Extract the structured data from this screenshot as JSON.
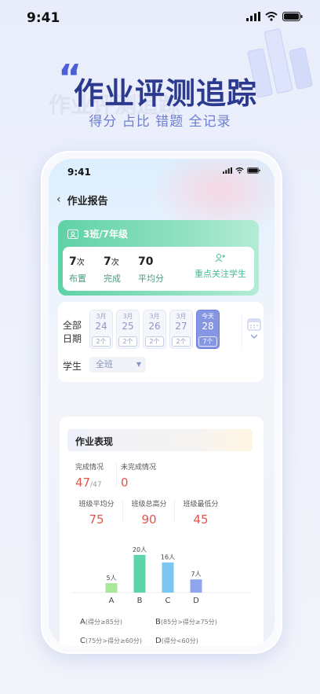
{
  "status_bar": {
    "time": "9:41"
  },
  "hero": {
    "title": "作业评测追踪",
    "subtitle": "得分 占比 错题 全记录",
    "quote_mark": "“",
    "shadow_text": "作业评测追踪"
  },
  "device": {
    "status_time": "9:41",
    "nav": {
      "back_icon": "chevron-left-icon",
      "title": "作业报告"
    },
    "class_card": {
      "name": "3班/7年级",
      "stats": [
        {
          "value": "7",
          "unit": "次",
          "label": "布置"
        },
        {
          "value": "7",
          "unit": "次",
          "label": "完成"
        },
        {
          "value": "70",
          "unit": "",
          "label": "平均分"
        }
      ],
      "focus_label": "重点关注学生",
      "accent": "#5fd2a6"
    },
    "date_filter": {
      "label": "全部日期",
      "dates": [
        {
          "month": "3月",
          "day": "24",
          "count": "2个",
          "active": false
        },
        {
          "month": "3月",
          "day": "25",
          "count": "2个",
          "active": false
        },
        {
          "month": "3月",
          "day": "26",
          "count": "2个",
          "active": false
        },
        {
          "month": "3月",
          "day": "27",
          "count": "2个",
          "active": false
        },
        {
          "month": "今天",
          "day": "28",
          "count": "7个",
          "active": true
        }
      ],
      "student_label": "学生",
      "student_value": "全班"
    },
    "performance": {
      "title": "作业表现",
      "completed_label": "完成情况",
      "completed_value": "47",
      "completed_total": "/47",
      "incomplete_label": "未完成情况",
      "incomplete_value": "0",
      "avg_label": "班级平均分",
      "avg_value": "75",
      "max_label": "班级总高分",
      "max_value": "90",
      "min_label": "班级最低分",
      "min_value": "45",
      "legend": [
        {
          "grade": "A",
          "range": "(得分≥85分)"
        },
        {
          "grade": "B",
          "range": "(85分>得分≥75分)"
        },
        {
          "grade": "C",
          "range": "(75分>得分≥60分)"
        },
        {
          "grade": "D",
          "range": "(得分<60分)"
        }
      ]
    }
  },
  "chart_data": {
    "type": "bar",
    "categories": [
      "A",
      "B",
      "C",
      "D"
    ],
    "values": [
      5,
      20,
      16,
      7
    ],
    "labels": [
      "5人",
      "20人",
      "16人",
      "7人"
    ],
    "colors": [
      "#a8e89a",
      "#5cd6a8",
      "#79c6f1",
      "#8fa5ee"
    ],
    "title": "",
    "xlabel": "",
    "ylabel": "",
    "ylim": [
      0,
      20
    ]
  }
}
